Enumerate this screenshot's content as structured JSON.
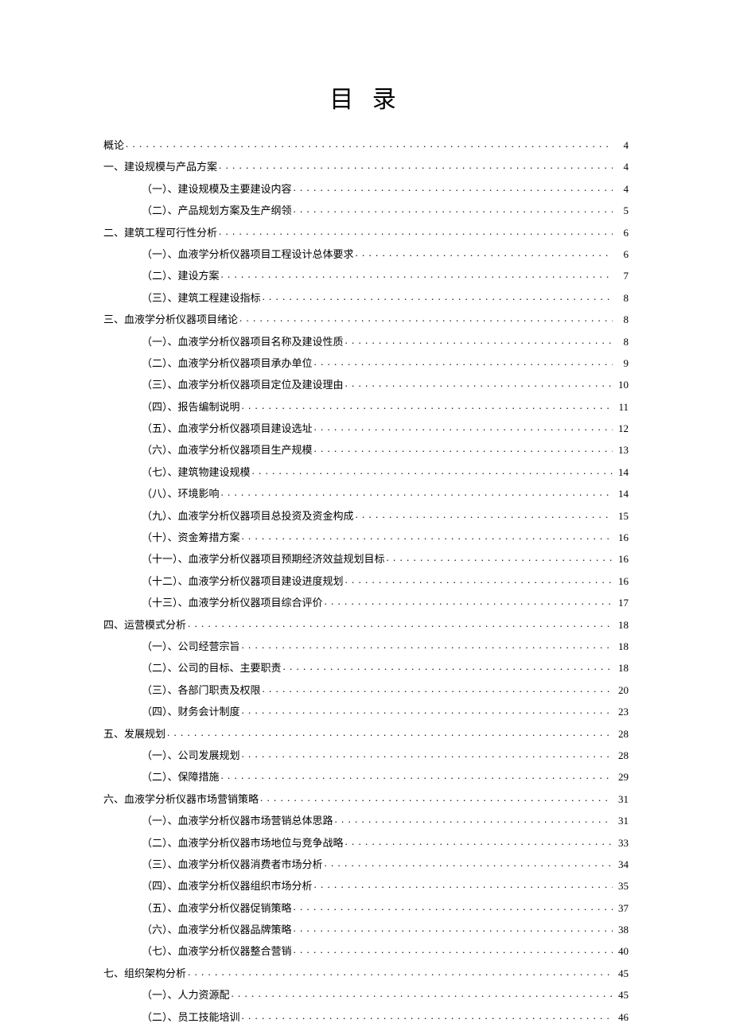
{
  "title": "目 录",
  "toc": [
    {
      "level": 0,
      "label": "概论",
      "page": "4"
    },
    {
      "level": 0,
      "label": "一、建设规模与产品方案",
      "page": "4"
    },
    {
      "level": 1,
      "label": "（一）、建设规模及主要建设内容",
      "page": "4"
    },
    {
      "level": 1,
      "label": "（二）、产品规划方案及生产纲领",
      "page": "5"
    },
    {
      "level": 0,
      "label": "二、建筑工程可行性分析",
      "page": "6"
    },
    {
      "level": 1,
      "label": "（一）、血液学分析仪器项目工程设计总体要求",
      "page": "6"
    },
    {
      "level": 1,
      "label": "（二）、建设方案",
      "page": "7"
    },
    {
      "level": 1,
      "label": "（三）、建筑工程建设指标",
      "page": "8"
    },
    {
      "level": 0,
      "label": "三、血液学分析仪器项目绪论",
      "page": "8"
    },
    {
      "level": 1,
      "label": "（一）、血液学分析仪器项目名称及建设性质",
      "page": "8"
    },
    {
      "level": 1,
      "label": "（二）、血液学分析仪器项目承办单位",
      "page": "9"
    },
    {
      "level": 1,
      "label": "（三）、血液学分析仪器项目定位及建设理由",
      "page": "10"
    },
    {
      "level": 1,
      "label": "（四）、报告编制说明",
      "page": "11"
    },
    {
      "level": 1,
      "label": "（五）、血液学分析仪器项目建设选址",
      "page": "12"
    },
    {
      "level": 1,
      "label": "（六）、血液学分析仪器项目生产规模",
      "page": "13"
    },
    {
      "level": 1,
      "label": "（七）、建筑物建设规模",
      "page": "14"
    },
    {
      "level": 1,
      "label": "（八）、环境影响",
      "page": "14"
    },
    {
      "level": 1,
      "label": "（九）、血液学分析仪器项目总投资及资金构成",
      "page": "15"
    },
    {
      "level": 1,
      "label": "（十）、资金筹措方案",
      "page": "16"
    },
    {
      "level": 1,
      "label": "（十一）、血液学分析仪器项目预期经济效益规划目标",
      "page": "16"
    },
    {
      "level": 1,
      "label": "（十二）、血液学分析仪器项目建设进度规划",
      "page": "16"
    },
    {
      "level": 1,
      "label": "（十三）、血液学分析仪器项目综合评价",
      "page": "17"
    },
    {
      "level": 0,
      "label": "四、运营模式分析",
      "page": "18"
    },
    {
      "level": 1,
      "label": "（一）、公司经营宗旨",
      "page": "18"
    },
    {
      "level": 1,
      "label": "（二）、公司的目标、主要职责",
      "page": "18"
    },
    {
      "level": 1,
      "label": "（三）、各部门职责及权限",
      "page": "20"
    },
    {
      "level": 1,
      "label": "（四）、财务会计制度",
      "page": "23"
    },
    {
      "level": 0,
      "label": "五、发展规划",
      "page": "28"
    },
    {
      "level": 1,
      "label": "（一）、公司发展规划",
      "page": "28"
    },
    {
      "level": 1,
      "label": "（二）、保障措施",
      "page": "29"
    },
    {
      "level": 0,
      "label": "六、血液学分析仪器市场营销策略",
      "page": "31"
    },
    {
      "level": 1,
      "label": "（一）、血液学分析仪器市场营销总体思路",
      "page": "31"
    },
    {
      "level": 1,
      "label": "（二）、血液学分析仪器市场地位与竞争战略",
      "page": "33"
    },
    {
      "level": 1,
      "label": "（三）、血液学分析仪器消费者市场分析",
      "page": "34"
    },
    {
      "level": 1,
      "label": "（四）、血液学分析仪器组织市场分析",
      "page": "35"
    },
    {
      "level": 1,
      "label": "（五）、血液学分析仪器促销策略",
      "page": "37"
    },
    {
      "level": 1,
      "label": "（六）、血液学分析仪器品牌策略",
      "page": "38"
    },
    {
      "level": 1,
      "label": "（七）、血液学分析仪器整合营销",
      "page": "40"
    },
    {
      "level": 0,
      "label": "七、组织架构分析",
      "page": "45"
    },
    {
      "level": 1,
      "label": "（一）、人力资源配",
      "page": "45"
    },
    {
      "level": 1,
      "label": "（二）、员工技能培训",
      "page": "46"
    }
  ]
}
